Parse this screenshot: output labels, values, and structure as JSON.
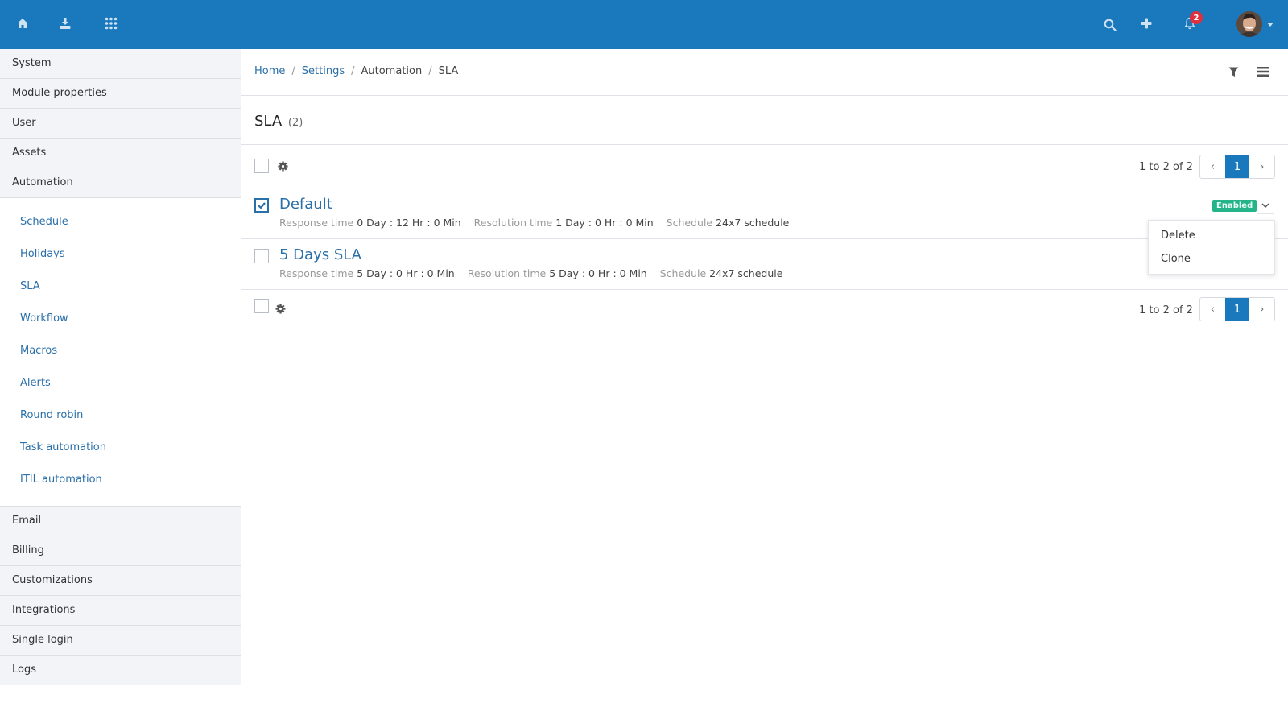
{
  "topbar": {
    "left_icons": [
      "home-icon",
      "download-icon",
      "apps-grid-icon"
    ],
    "right_icons": [
      "search-icon",
      "plus-icon",
      "bell-icon"
    ],
    "notification_count": "2",
    "brand_color": "#1a78bd"
  },
  "sidebar": {
    "top_items": [
      {
        "label": "System"
      },
      {
        "label": "Module properties"
      },
      {
        "label": "User"
      },
      {
        "label": "Assets"
      },
      {
        "label": "Automation"
      }
    ],
    "sub_items": [
      {
        "label": "Schedule"
      },
      {
        "label": "Holidays"
      },
      {
        "label": "SLA"
      },
      {
        "label": "Workflow"
      },
      {
        "label": "Macros"
      },
      {
        "label": "Alerts"
      },
      {
        "label": "Round robin"
      },
      {
        "label": "Task automation"
      },
      {
        "label": "ITIL automation"
      }
    ],
    "bottom_items": [
      {
        "label": "Email"
      },
      {
        "label": "Billing"
      },
      {
        "label": "Customizations"
      },
      {
        "label": "Integrations"
      },
      {
        "label": "Single login"
      },
      {
        "label": "Logs"
      }
    ]
  },
  "breadcrumb": {
    "home": "Home",
    "settings": "Settings",
    "automation": "Automation",
    "current": "SLA",
    "separator": "/"
  },
  "page": {
    "title": "SLA",
    "count": "(2)"
  },
  "pagination": {
    "range_text": "1 to 2 of 2",
    "prev": "‹",
    "current_page": "1",
    "next": "›"
  },
  "rows": [
    {
      "name": "Default",
      "checked": true,
      "response_label": "Response time",
      "response_value": "0 Day : 12 Hr : 0 Min",
      "resolution_label": "Resolution time",
      "resolution_value": "1 Day : 0 Hr : 0 Min",
      "schedule_label": "Schedule",
      "schedule_value": "24x7 schedule",
      "status": "Enabled",
      "status_color": "#25b489"
    },
    {
      "name": "5 Days SLA",
      "checked": false,
      "response_label": "Response time",
      "response_value": "5 Day : 0 Hr : 0 Min",
      "resolution_label": "Resolution time",
      "resolution_value": "5 Day : 0 Hr : 0 Min",
      "schedule_label": "Schedule",
      "schedule_value": "24x7 schedule"
    }
  ],
  "row_menu": {
    "items": [
      {
        "label": "Delete"
      },
      {
        "label": "Clone"
      }
    ]
  }
}
